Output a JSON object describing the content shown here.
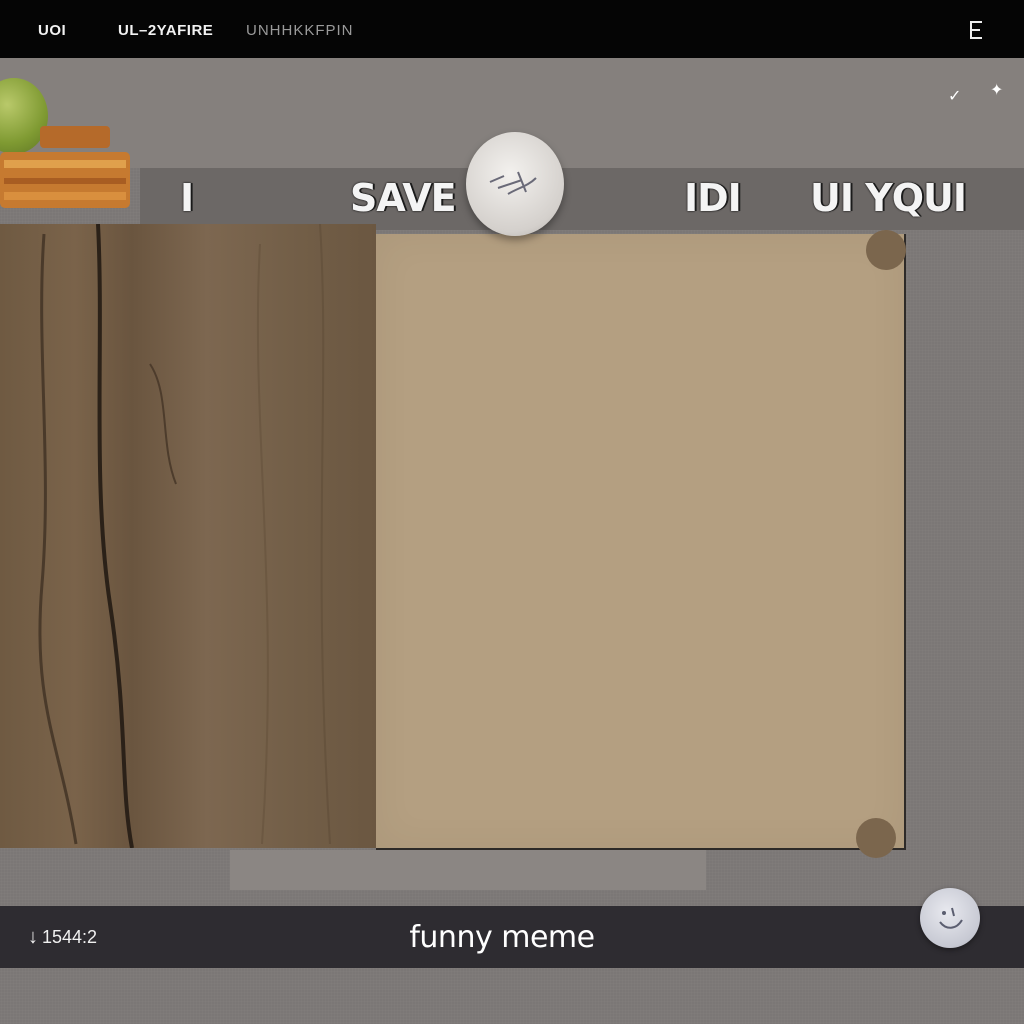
{
  "top_bar": {
    "tab1": "UOI",
    "tab2": "UL–2YAFIRE",
    "tab3": "UNHHKKFPIN",
    "menu_icon": "menu-icon"
  },
  "banner": {
    "word1": "I",
    "word2": "SAVE",
    "word3": "IDI",
    "word4": "UI YQUI"
  },
  "bottom_bar": {
    "counter": "1544:2",
    "caption": "funny meme"
  },
  "colors": {
    "top_bar": "#050505",
    "surface": "#7b7776",
    "card": "#b49f81",
    "wood": "#735e46",
    "bottom_bar": "#2e2c31"
  }
}
